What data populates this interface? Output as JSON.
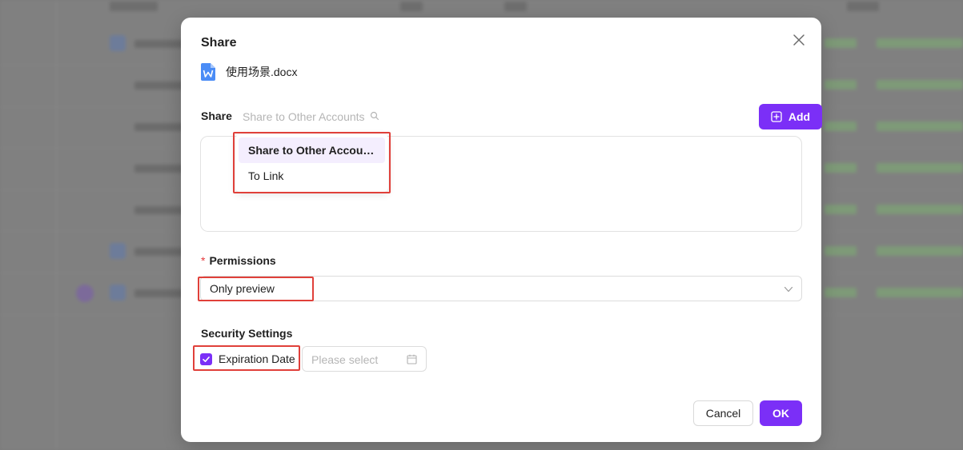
{
  "modal": {
    "title": "Share",
    "file": {
      "name": "使用场景.docx",
      "icon": "word-doc-icon",
      "icon_color": "#4a8cf6"
    },
    "share": {
      "label": "Share",
      "search_placeholder": "Share to Other Accounts",
      "add_label": "Add",
      "dropdown_items": [
        {
          "label": "Share to Other Accou…",
          "selected": true
        },
        {
          "label": "To Link",
          "selected": false
        }
      ]
    },
    "permissions": {
      "required_mark": "*",
      "label": "Permissions",
      "selected_value": "Only preview"
    },
    "security": {
      "label": "Security Settings",
      "expiration_label": "Expiration Date",
      "expiration_checked": true,
      "date_placeholder": "Please select"
    },
    "footer": {
      "cancel_label": "Cancel",
      "ok_label": "OK"
    }
  },
  "colors": {
    "accent": "#7b2ff7",
    "highlight": "#e0403a",
    "required": "#e5383b"
  }
}
